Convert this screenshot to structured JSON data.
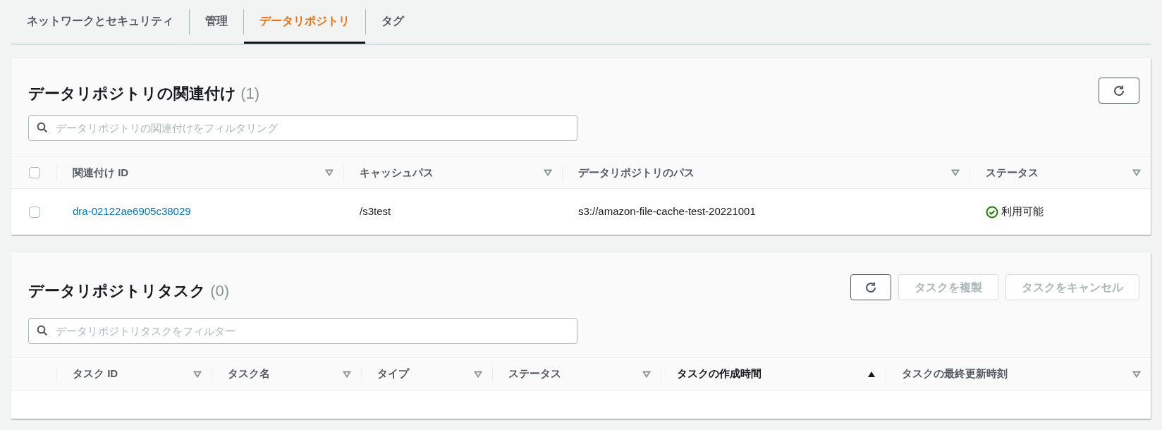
{
  "tabs": [
    {
      "label": "ネットワークとセキュリティ",
      "selected": false
    },
    {
      "label": "管理",
      "selected": false
    },
    {
      "label": "データリポジトリ",
      "selected": true
    },
    {
      "label": "タグ",
      "selected": false
    }
  ],
  "associations": {
    "title": "データリポジトリの関連付け",
    "count": "(1)",
    "filter": {
      "placeholder": "データリポジトリの関連付けをフィルタリング"
    },
    "select_all": {
      "checked": false
    },
    "columns": [
      {
        "label": "関連付け ID",
        "sorted": false
      },
      {
        "label": "キャッシュパス",
        "sorted": false
      },
      {
        "label": "データリポジトリのパス",
        "sorted": false
      },
      {
        "label": "ステータス",
        "sorted": false
      }
    ],
    "rows": [
      {
        "checked": false,
        "id": "dra-02122ae6905c38029",
        "cache_path": "/s3test",
        "repository_path": "s3://amazon-file-cache-test-20221001",
        "status": "利用可能",
        "kind": "available"
      }
    ]
  },
  "tasks": {
    "title": "データリポジトリタスク",
    "count": "(0)",
    "filter": {
      "placeholder": "データリポジトリタスクをフィルター"
    },
    "buttons": [
      {
        "label": "タスクを複製",
        "disabled": true
      },
      {
        "label": "タスクをキャンセル",
        "disabled": true
      }
    ],
    "columns": [
      {
        "label": "タスク ID",
        "sorted": false
      },
      {
        "label": "タスク名",
        "sorted": false
      },
      {
        "label": "タイプ",
        "sorted": false
      },
      {
        "label": "ステータス",
        "sorted": false
      },
      {
        "label": "タスクの作成時間",
        "sorted": true
      },
      {
        "label": "タスクの最終更新時刻",
        "sorted": false
      }
    ]
  }
}
